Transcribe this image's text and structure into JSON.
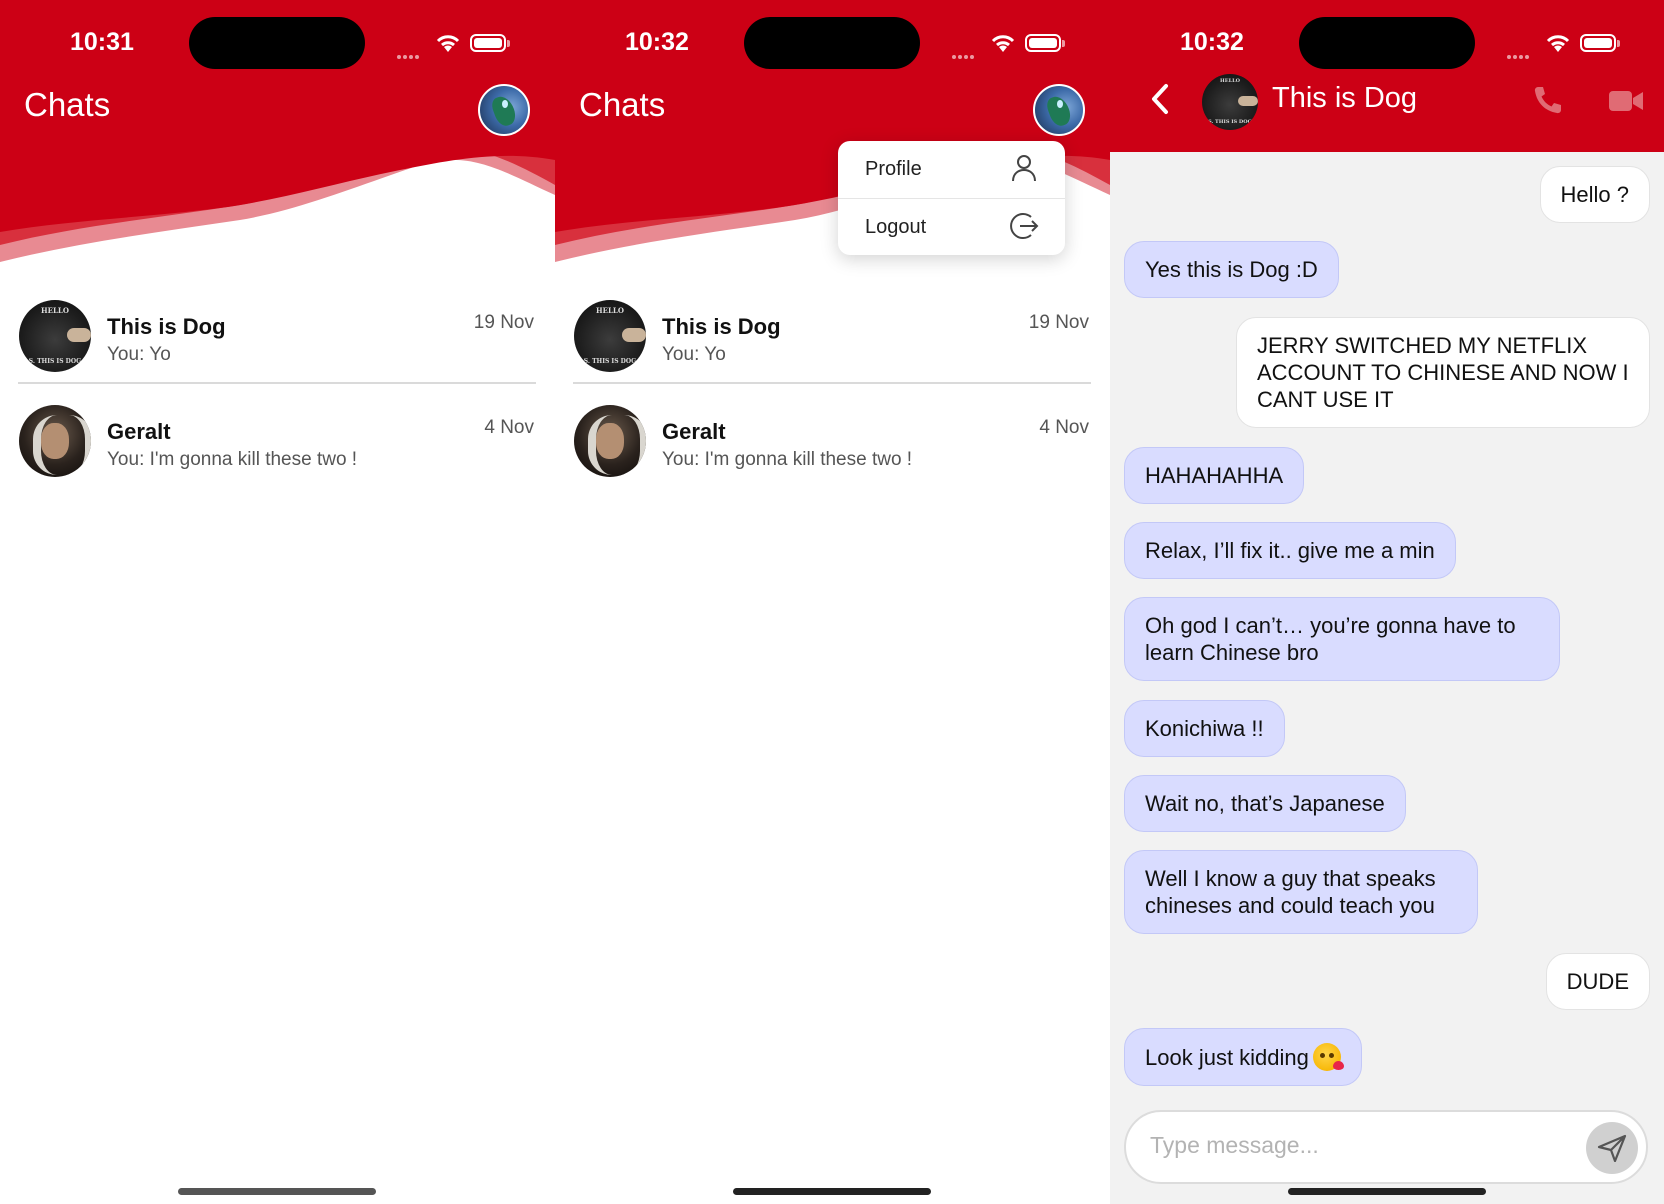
{
  "colors": {
    "brand_red": "#cc0015",
    "bubble_in": "#d9dcff",
    "bubble_out": "#ffffff",
    "page_bg": "#f2f2f2"
  },
  "screens": [
    {
      "time": "10:31",
      "title": "Chats"
    },
    {
      "time": "10:32",
      "title": "Chats"
    },
    {
      "time": "10:32"
    }
  ],
  "chats": [
    {
      "name": "This is Dog",
      "preview": "You: Yo",
      "date": "19 Nov",
      "avatar": "dog-avatar"
    },
    {
      "name": "Geralt",
      "preview": "You: I'm gonna kill these two !",
      "date": "4 Nov",
      "avatar": "geralt-avatar"
    }
  ],
  "avatar_text": {
    "hello": "HELLO",
    "is_dog": "S. THIS IS DOG"
  },
  "menu": {
    "profile_label": "Profile",
    "logout_label": "Logout"
  },
  "conversation": {
    "contact_name": "This is Dog",
    "messages": [
      {
        "dir": "out",
        "text": "Hello ?"
      },
      {
        "dir": "in",
        "text": "Yes this is Dog :D"
      },
      {
        "dir": "out",
        "text": "JERRY SWITCHED MY NETFLIX ACCOUNT TO CHINESE AND NOW I CANT USE IT"
      },
      {
        "dir": "in",
        "text": "HAHAHAHHA"
      },
      {
        "dir": "in",
        "text": "Relax, I’ll fix it.. give me a min"
      },
      {
        "dir": "in",
        "text": "Oh god I can’t… you’re gonna have to learn Chinese bro"
      },
      {
        "dir": "in",
        "text": "Konichiwa !!"
      },
      {
        "dir": "in",
        "text": "Wait no, that’s Japanese"
      },
      {
        "dir": "in",
        "text": "Well I know a guy that speaks chineses and could teach you"
      },
      {
        "dir": "out",
        "text": "DUDE"
      },
      {
        "dir": "in",
        "text": "Look just kidding",
        "emoji": "kissing-face-emoji"
      }
    ],
    "input_placeholder": "Type message..."
  }
}
